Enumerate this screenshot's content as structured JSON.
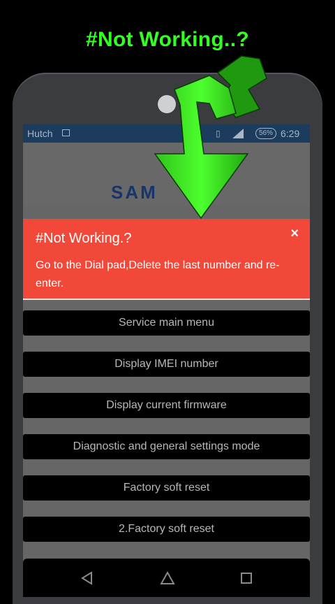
{
  "overlay": {
    "headline": "#Not Working..?"
  },
  "status_bar": {
    "carrier": "Hutch",
    "battery": "56%",
    "time": "6:29"
  },
  "app": {
    "brand": "SAM"
  },
  "popup": {
    "title": "#Not Working.?",
    "message": "Go to the Dial pad,Delete the last number and re-enter.",
    "close_label": "×"
  },
  "menu": {
    "items": [
      {
        "label": "Service main menu"
      },
      {
        "label": "Display IMEI number"
      },
      {
        "label": "Display current firmware"
      },
      {
        "label": "Diagnostic and general settings mode"
      },
      {
        "label": "Factory soft reset"
      },
      {
        "label": "2.Factory soft reset"
      }
    ]
  },
  "icons": {
    "back": "back-icon",
    "home": "home-icon",
    "recents": "recents-icon",
    "arrow": "green-arrow-icon"
  },
  "colors": {
    "headline": "#33ff22",
    "popup_bg": "#f14839",
    "status_bar": "#1b3c5c",
    "arrow": "#39e820",
    "brand": "#17356b"
  }
}
